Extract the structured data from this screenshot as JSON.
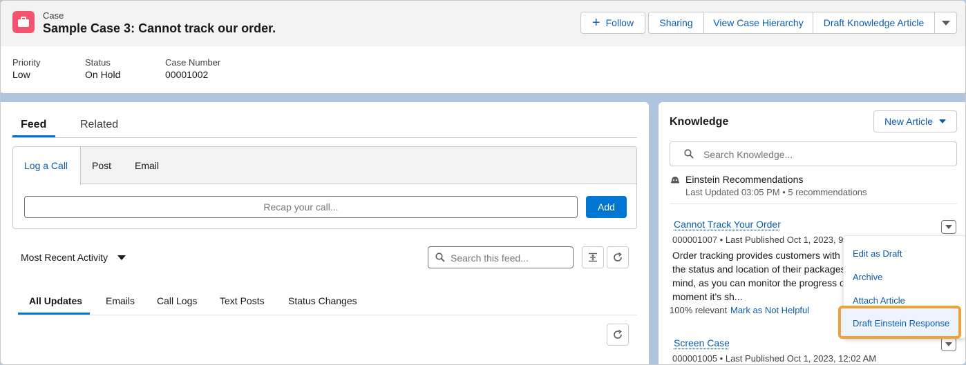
{
  "header": {
    "object_label": "Case",
    "title": "Sample Case 3: Cannot track our order.",
    "buttons": {
      "follow": "Follow",
      "sharing": "Sharing",
      "view_hierarchy": "View Case Hierarchy",
      "draft_article": "Draft Knowledge Article"
    },
    "fields": [
      {
        "label": "Priority",
        "value": "Low"
      },
      {
        "label": "Status",
        "value": "On Hold"
      },
      {
        "label": "Case Number",
        "value": "00001002"
      }
    ]
  },
  "feed": {
    "tabs": [
      "Feed",
      "Related"
    ],
    "publisher": {
      "tabs": [
        "Log a Call",
        "Post",
        "Email"
      ],
      "input_placeholder": "Recap your call...",
      "add_label": "Add"
    },
    "activity_filter": "Most Recent Activity",
    "search_placeholder": "Search this feed...",
    "subtabs": [
      "All Updates",
      "Emails",
      "Call Logs",
      "Text Posts",
      "Status Changes"
    ]
  },
  "knowledge": {
    "title": "Knowledge",
    "new_article_label": "New Article",
    "search_placeholder": "Search Knowledge...",
    "einstein": {
      "title": "Einstein Recommendations",
      "subtitle": "Last Updated 03:05 PM • 5 recommendations"
    },
    "articles": [
      {
        "title": "Cannot Track Your Order",
        "meta": "000001007 • Last Published Oct 1, 2023, 9",
        "snippet": [
          "Order tracking provides customers with r",
          "the status and location of their packages.",
          "mind, as you can monitor the progress of",
          "moment it's sh..."
        ],
        "relevance": "100% relevant",
        "not_helpful": "Mark as Not Helpful"
      },
      {
        "title": "Screen Case",
        "meta": "000001005 • Last Published Oct 1, 2023, 12:02 AM"
      }
    ],
    "menu": [
      "Edit as Draft",
      "Archive",
      "Attach Article",
      "Draft Einstein Response"
    ]
  },
  "colors": {
    "brand": "#0176d3",
    "link": "#0b5cab",
    "case_icon": "#f2536d",
    "highlight": "#f0a23a",
    "backdrop": "#b0c4df"
  },
  "icons": [
    "briefcase-icon",
    "plus-icon",
    "chevron-down-icon",
    "search-icon",
    "collapse-icon",
    "refresh-icon",
    "einstein-icon"
  ]
}
